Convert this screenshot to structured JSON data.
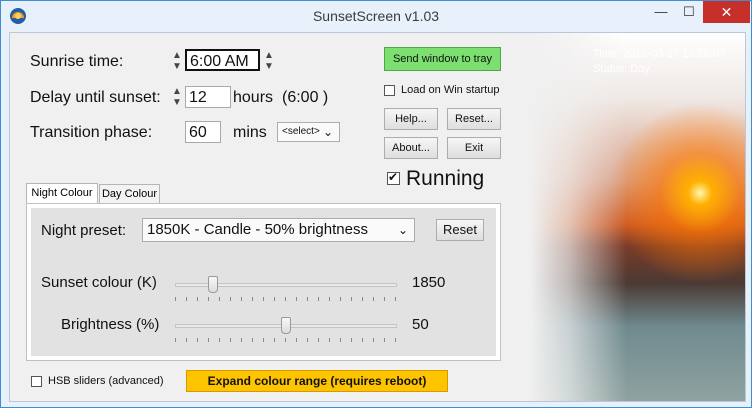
{
  "window": {
    "title": "SunsetScreen v1.03"
  },
  "controls": {
    "minimize": "—",
    "maximize": "☐",
    "close": "✕"
  },
  "left": {
    "sunrise_label": "Sunrise time:",
    "sunrise_value": "6:00 AM",
    "delay_label": "Delay until sunset:",
    "delay_value": "12",
    "delay_unit": "hours",
    "delay_paren": "(6:00 )",
    "transition_label": "Transition phase:",
    "transition_value": "60",
    "transition_unit": "mins",
    "transition_select": "<select>"
  },
  "buttons": {
    "send_to_tray": "Send window to tray",
    "load_on_startup": "Load on Win startup",
    "help": "Help...",
    "reset": "Reset...",
    "about": "About...",
    "exit": "Exit",
    "running": "Running"
  },
  "tabs": [
    {
      "label": "Night Colour",
      "active": true
    },
    {
      "label": "Day Colour",
      "active": false
    }
  ],
  "night": {
    "preset_label": "Night preset:",
    "preset_value": "1850K - Candle - 50% brightness",
    "reset_label": "Reset",
    "sunset_label": "Sunset colour (K)",
    "sunset_value": "1850",
    "brightness_label": "Brightness (%)",
    "brightness_value": "50"
  },
  "bottom": {
    "hsb_label": "HSB sliders (advanced)",
    "expand_label": "Expand colour range (requires reboot)"
  },
  "status": {
    "time": "Time: 2015-03-17 13:55:07",
    "status": "Status: Day"
  },
  "icons": {
    "app": "sunset-app-icon",
    "spinner": "spinner-icon",
    "dropdown": "chevron-down-icon"
  },
  "colors": {
    "accent_green": "#7be06f",
    "accent_orange": "#ffc400",
    "close_red": "#c7302a"
  }
}
